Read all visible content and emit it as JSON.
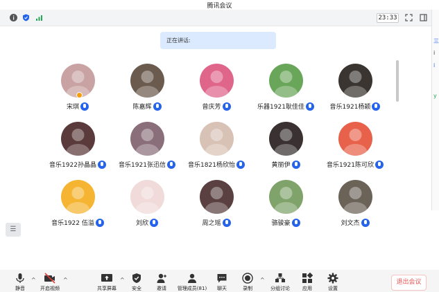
{
  "window": {
    "title": "腾讯会议"
  },
  "topbar": {
    "icons": [
      {
        "name": "info-icon",
        "color": "#555555"
      },
      {
        "name": "shield-icon",
        "color": "#2563eb"
      },
      {
        "name": "signal-icon",
        "color": "#22a855"
      }
    ],
    "time": "23:33",
    "right_icons": [
      "fullscreen-icon",
      "layout-icon"
    ]
  },
  "speaking": {
    "label": "正在讲话:"
  },
  "participants": [
    {
      "name": "宋琪",
      "avatar": "avatar-photo",
      "color": "#c9a3a3",
      "has_badge": true
    },
    {
      "name": "陈嘉辉",
      "avatar": "avatar-photo",
      "color": "#6b5b4e"
    },
    {
      "name": "曾庆芳",
      "avatar": "avatar-photo",
      "color": "#e0658b"
    },
    {
      "name": "乐器1921耿佳佳",
      "avatar": "avatar-photo",
      "color": "#6aa65a"
    },
    {
      "name": "音乐1921杨颖",
      "avatar": "avatar-photo",
      "color": "#3a3530"
    },
    {
      "name": "音乐1922孙晶晶",
      "avatar": "avatar-photo",
      "color": "#5a3a3a"
    },
    {
      "name": "音乐1921张迅信",
      "avatar": "avatar-photo",
      "color": "#8a6f7a"
    },
    {
      "name": "音乐1821杨欣怡",
      "avatar": "avatar-photo",
      "color": "#d8c2b5"
    },
    {
      "name": "黄丽伊",
      "avatar": "avatar-photo",
      "color": "#3a3232"
    },
    {
      "name": "音乐1921陈可欣",
      "avatar": "avatar-photo",
      "color": "#e8614a"
    },
    {
      "name": "音乐1922 伍溢",
      "avatar": "avatar-photo",
      "color": "#f5b431"
    },
    {
      "name": "刘欣",
      "avatar": "avatar-photo",
      "color": "#f1dada"
    },
    {
      "name": "周之瑶",
      "avatar": "avatar-photo",
      "color": "#5a4040"
    },
    {
      "name": "骆骏豪",
      "avatar": "avatar-photo",
      "color": "#7fa36a"
    },
    {
      "name": "刘文杰",
      "avatar": "avatar-photo",
      "color": "#6b6358"
    }
  ],
  "toolbar": {
    "mute": "静音",
    "video": "开启视频",
    "share": "共享屏幕",
    "security": "安全",
    "invite": "邀请",
    "members": "管理成员(81)",
    "chat": "聊天",
    "record": "录制",
    "breakout": "分组讨论",
    "apps": "应用",
    "settings": "设置",
    "leave": "退出会议"
  },
  "colors": {
    "accent": "#2563eb",
    "leave": "#e85454",
    "speaking_bg": "#dbeafe"
  }
}
